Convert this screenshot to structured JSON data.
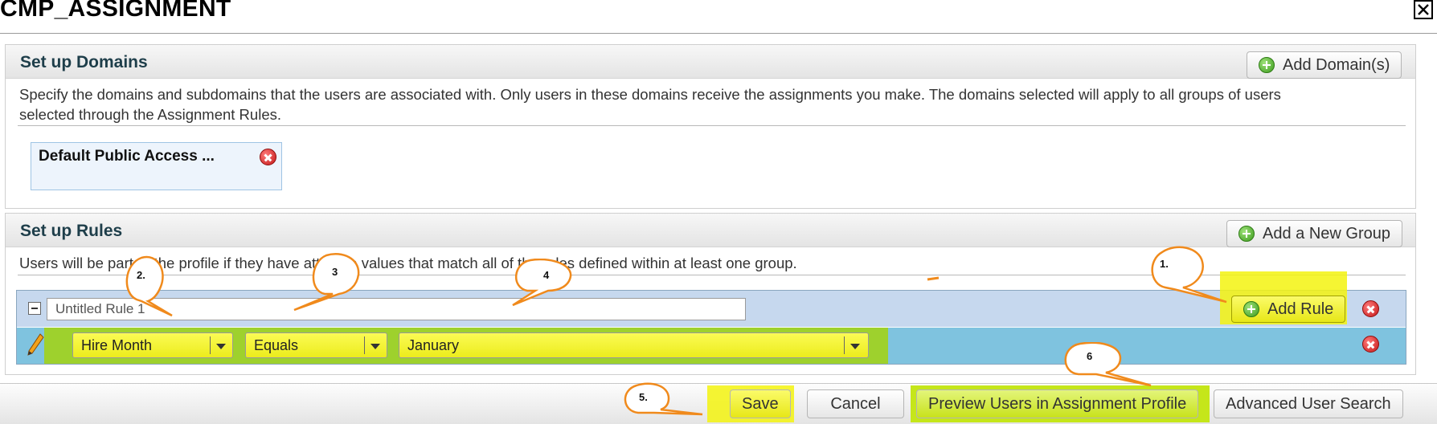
{
  "dialog": {
    "title": "CMP_ASSIGNMENT"
  },
  "domains": {
    "title": "Set up Domains",
    "add_button": "Add Domain(s)",
    "description_line1": "Specify the domains and subdomains that the users are associated with. Only users in these domains receive the assignments you make. The domains selected will apply to all groups of users",
    "description_line2": "selected through the Assignment Rules.",
    "selected": [
      "Default Public Access ..."
    ]
  },
  "rules": {
    "title": "Set up Rules",
    "add_group_button": "Add a New Group",
    "description": "Users will be part of the profile if they have attribute values that match all of the rules defined within at least one group.",
    "group": {
      "name_value": "Untitled Rule 1",
      "add_rule_button": "Add Rule",
      "rule": {
        "attribute": "Hire Month",
        "operator": "Equals",
        "value": "January"
      }
    }
  },
  "footer": {
    "save": "Save",
    "cancel": "Cancel",
    "preview": "Preview Users in Assignment Profile",
    "advanced_search": "Advanced User Search"
  },
  "annotations": {
    "c1": "1.",
    "c2": "2.",
    "c3": "3",
    "c4": "4",
    "c5": "5.",
    "c6": "6"
  },
  "colors": {
    "highlight_yellow": "#f3f30f",
    "highlight_green": "#9ed12d",
    "group_header_bg": "#c6d8ee",
    "rule_row_bg": "#7fc3df",
    "callout_orange": "#f08a1c",
    "panel_title": "#1e3e4a"
  }
}
